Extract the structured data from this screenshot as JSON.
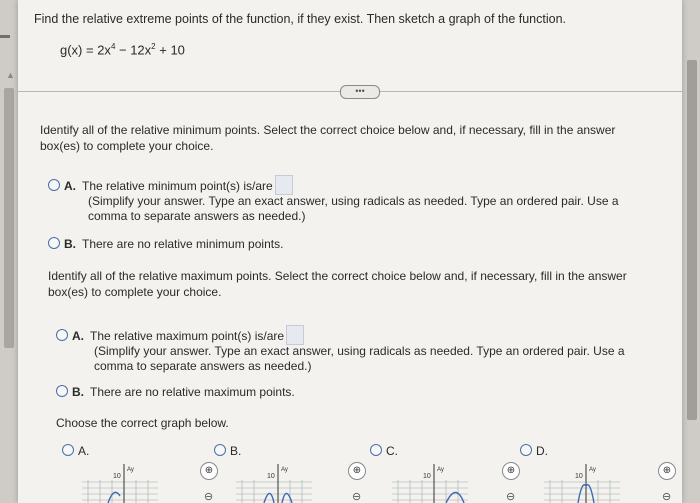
{
  "question": {
    "title": "Find the relative extreme points of the function, if they exist. Then sketch a graph of the function.",
    "formula_prefix": "g(x) = 2x",
    "formula_exp1": "4",
    "formula_mid": " − 12x",
    "formula_exp2": "2",
    "formula_suffix": " + 10"
  },
  "more_button": "•••",
  "minimum": {
    "prompt_line1": "Identify all of the relative minimum points. Select the correct choice below and, if necessary, fill in the answer",
    "prompt_line2": "box(es) to complete your choice.",
    "option_a_letter": "A.",
    "option_a_text": "The relative minimum point(s) is/are",
    "option_a_note1": "(Simplify your answer. Type an exact answer, using radicals as needed. Type an ordered pair. Use a",
    "option_a_note2": "comma to separate answers as needed.)",
    "option_b_letter": "B.",
    "option_b_text": "There are no relative minimum points."
  },
  "maximum": {
    "prompt_line1": "Identify all of the relative maximum points. Select the correct choice below and, if necessary, fill in the answer",
    "prompt_line2": "box(es) to complete your choice.",
    "option_a_letter": "A.",
    "option_a_text": "The relative maximum point(s) is/are",
    "option_a_note1": "(Simplify your answer. Type an exact answer, using radicals as needed. Type an ordered pair. Use a",
    "option_a_note2": "comma to separate answers as needed.)",
    "option_b_letter": "B.",
    "option_b_text": "There are no relative maximum points."
  },
  "graph": {
    "prompt": "Choose the correct graph below.",
    "options": [
      "A.",
      "B.",
      "C.",
      "D."
    ],
    "y_axis_label": "Ay",
    "tick_label": "10"
  },
  "colors": {
    "accent": "#4a6fa5",
    "curve": "#3d6bb3"
  }
}
